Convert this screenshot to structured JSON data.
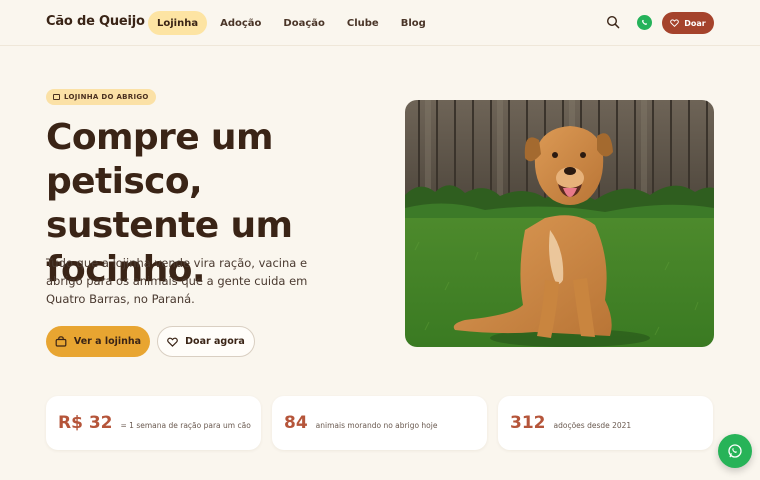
{
  "brand": {
    "name": "Cão de Queijo"
  },
  "nav": {
    "links": [
      {
        "label": "Lojinha",
        "active": true
      },
      {
        "label": "Adoção",
        "active": false
      },
      {
        "label": "Doação",
        "active": false
      },
      {
        "label": "Clube",
        "active": false
      },
      {
        "label": "Blog",
        "active": false
      }
    ],
    "donate_label": "Doar"
  },
  "hero": {
    "badge": "LOJINHA DO ABRIGO",
    "title": "Compre um petisco, sustente um focinho.",
    "description": "Tudo que a lojinha vende vira ração, vacina e abrigo para os animais que a gente cuida em Quatro Barras, no Paraná.",
    "primary_button": "Ver a lojinha",
    "secondary_button": "Doar agora"
  },
  "stats": [
    {
      "value": "R$ 32",
      "label": "= 1 semana de ração para um cão"
    },
    {
      "value": "84",
      "label": "animais morando no abrigo hoje"
    },
    {
      "value": "312",
      "label": "adoções desde 2021"
    }
  ],
  "colors": {
    "background": "#faf6ee",
    "accent": "#e8a531",
    "brand_red": "#a5432c",
    "stat_number": "#b5553a",
    "whatsapp": "#27b358"
  },
  "icons": {
    "search": "search-icon",
    "whatsapp": "whatsapp-icon",
    "heart": "heart-icon",
    "bag": "shopping-bag-icon",
    "badge": "store-icon"
  }
}
